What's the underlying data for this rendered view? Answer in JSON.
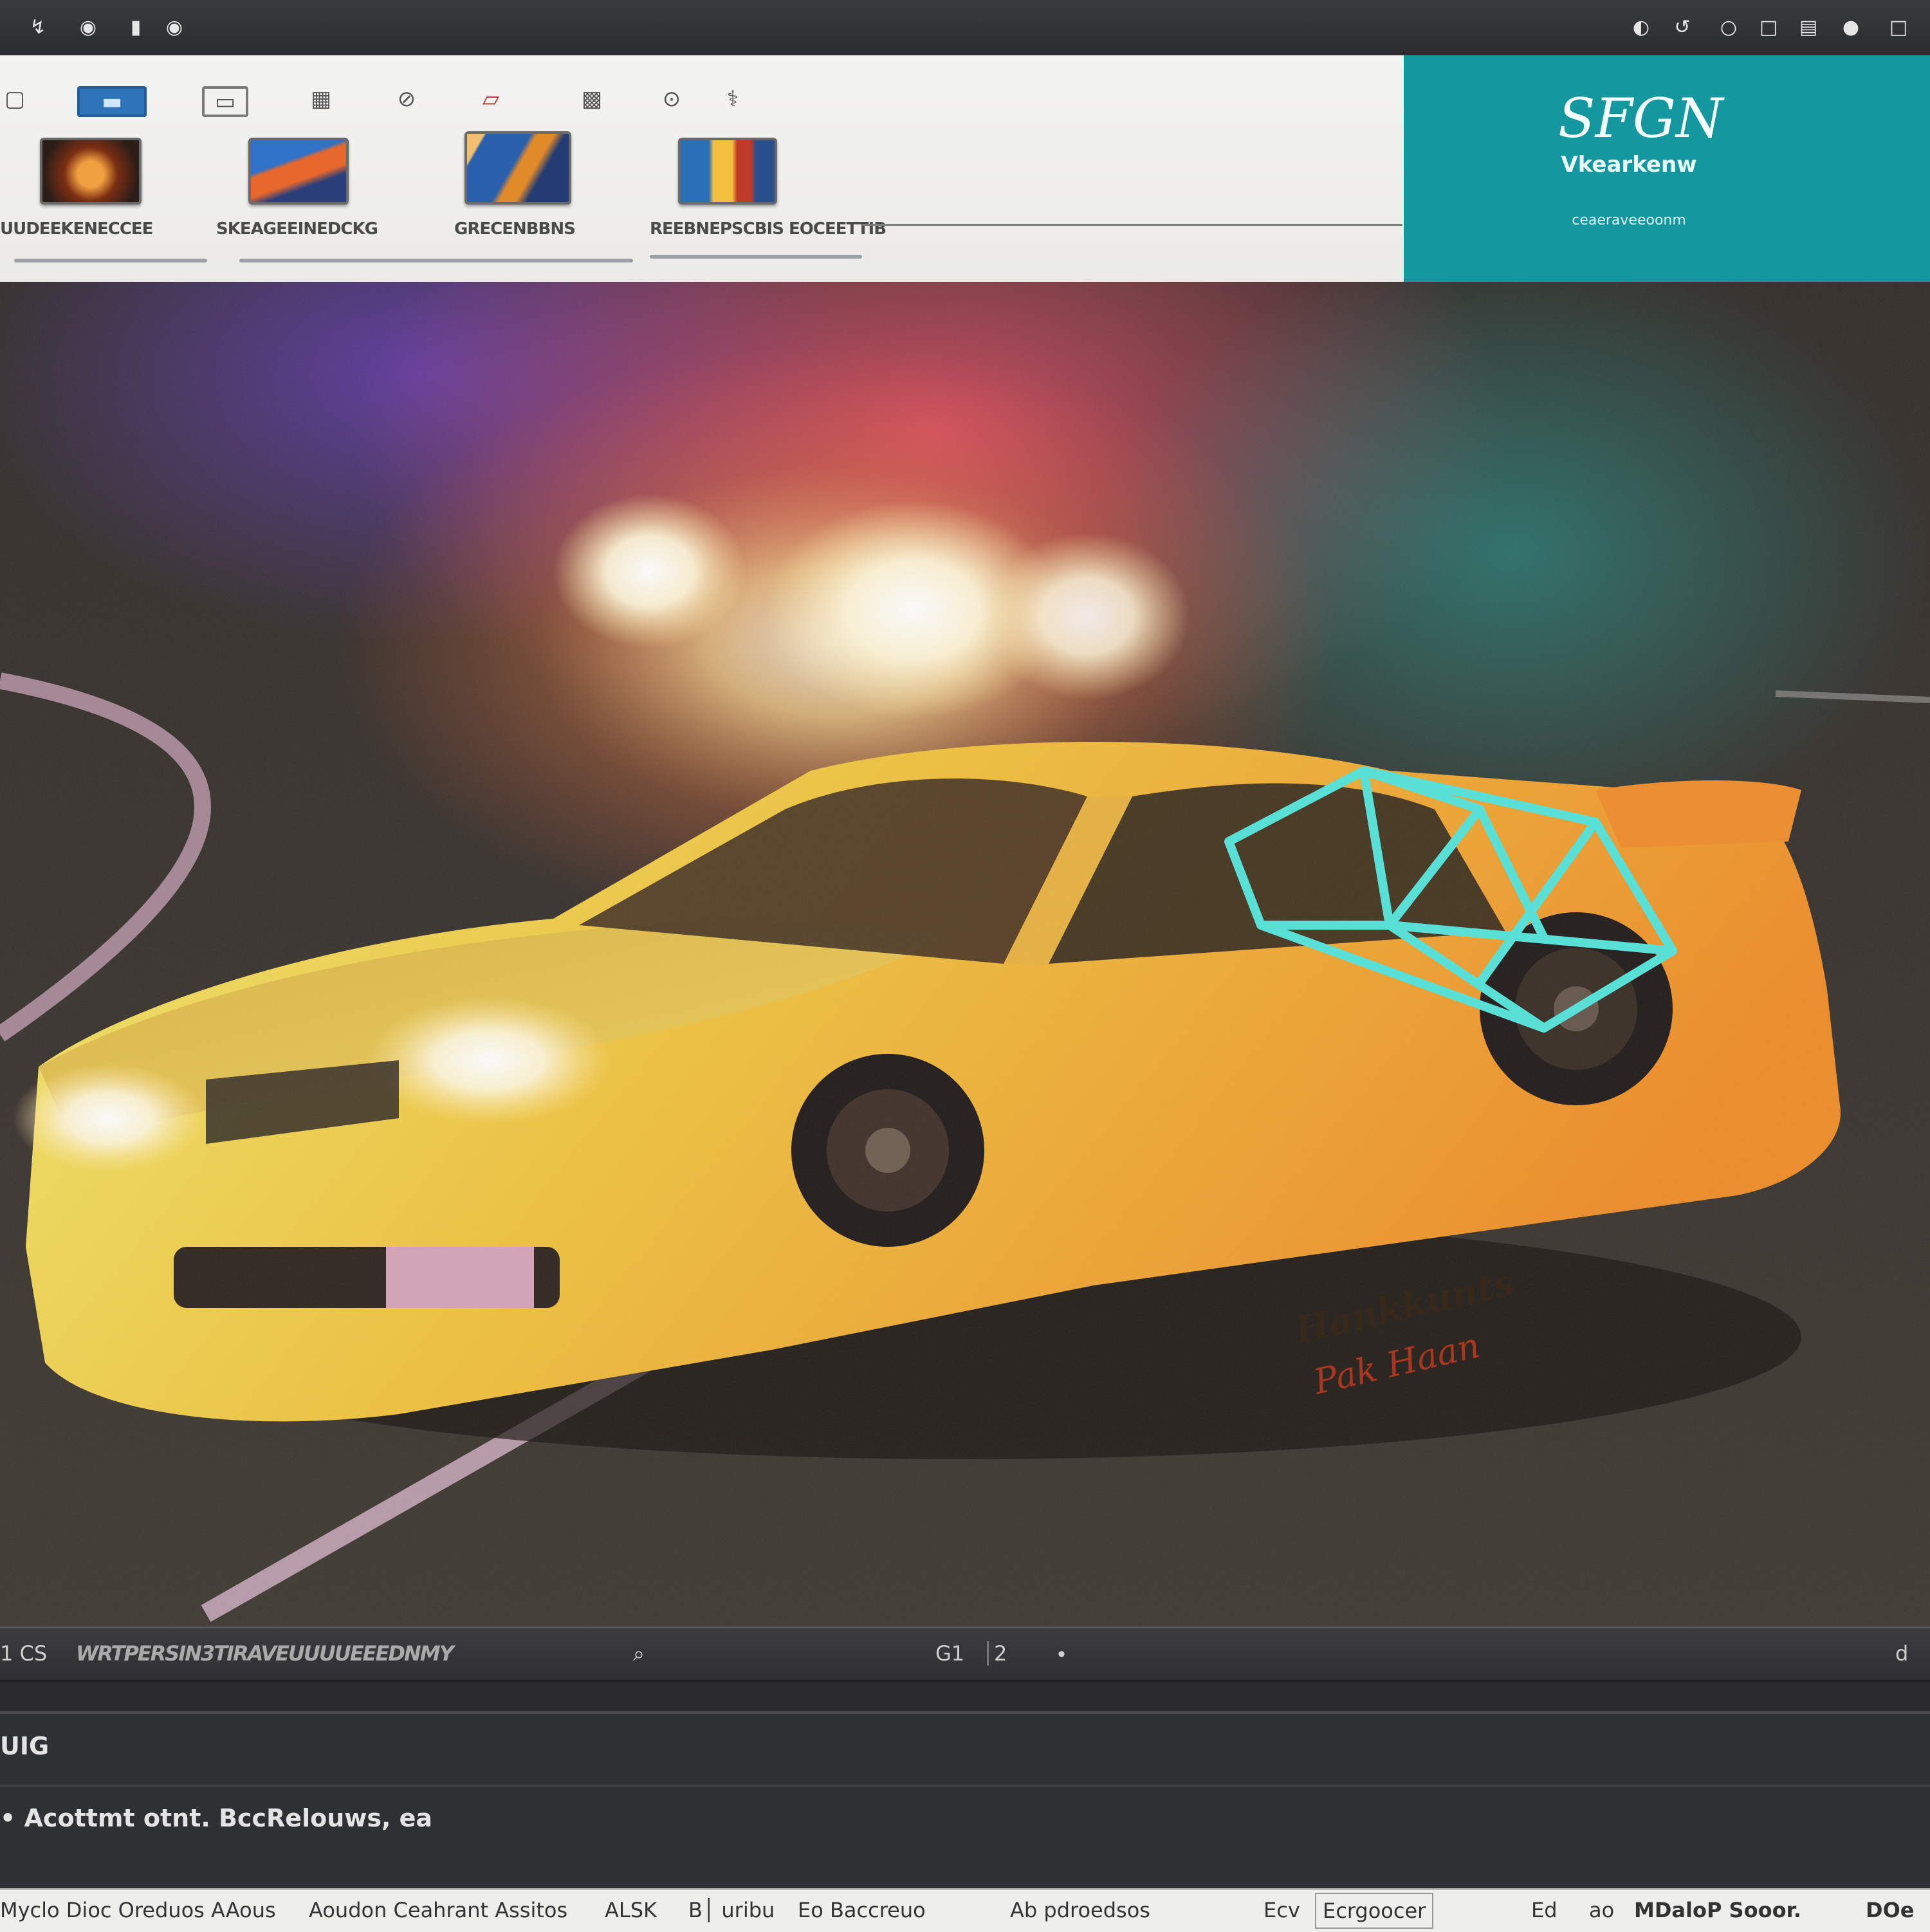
{
  "titlebar": {
    "left_controls": [
      "↯",
      "◉",
      "▮",
      "◉"
    ],
    "right_controls": [
      "◐",
      "↺",
      "○",
      "□",
      "▤",
      "●",
      "□"
    ]
  },
  "browser": {
    "tools": [
      "▢",
      "▬",
      "▭",
      "▦",
      "⊘",
      "▱",
      "▩",
      "⊙",
      "⚕"
    ],
    "thumbnails": [
      {
        "label": "UUDEEKENECCEE"
      },
      {
        "label": "SKEAGEEINEDCKG"
      },
      {
        "label": "GRECENBBNS"
      },
      {
        "label": "REEBNEPSCBIS EOCEETTIB"
      }
    ]
  },
  "brand": {
    "logo": "SFGN",
    "name": "Vkearkenw",
    "url": "ceaeraveeoonm"
  },
  "viewport": {
    "car_lettering": "Hankkunts",
    "car_script": "Pak Haan"
  },
  "timeline": {
    "left_text": "1 CS",
    "title_text": "WRTPERSIN3TIRAVEUUUUEEEDNMY",
    "search_icon_label": "⌕",
    "frame_a": "G1",
    "frame_b": "2",
    "frame_c": "∙",
    "end_icon": "d"
  },
  "info": {
    "header": "UIG",
    "detail": "• Acottmt otnt. BccRelouws, ea"
  },
  "statusbar": {
    "segments": [
      "Myclo Dioc Oreduos AAous",
      "Aoudon Ceahrant Assitos",
      "ALSK",
      "B│ uribu",
      "Eo Baccreuo",
      "Ab pdroedsos",
      "Ecv",
      "Ecrgoocer",
      "Ed",
      "ao",
      "MDaloP Sooor.",
      "DOe"
    ]
  },
  "colors": {
    "brand_teal": "#15979f",
    "car_yellow": "#e8c23a",
    "cage_cyan": "#4fe3d9"
  }
}
